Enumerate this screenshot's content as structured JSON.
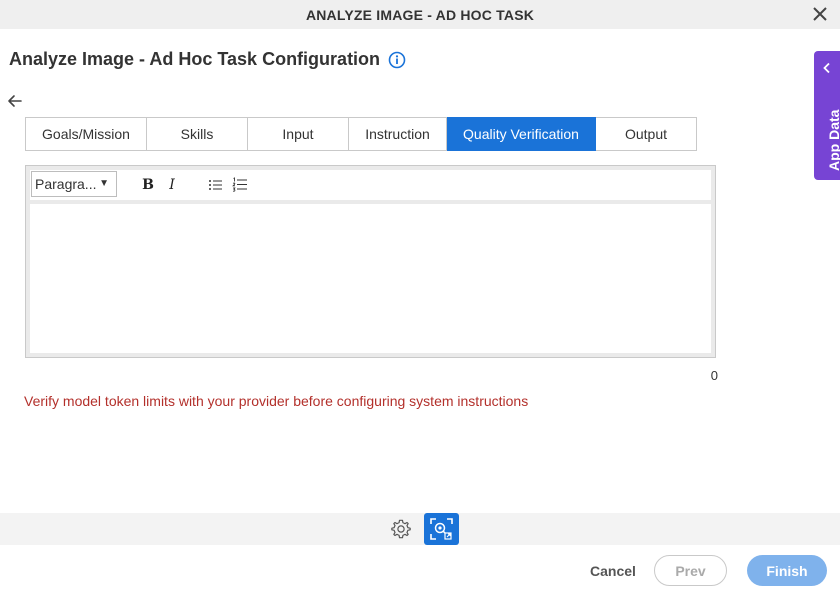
{
  "window": {
    "title": "ANALYZE IMAGE - AD HOC TASK"
  },
  "page": {
    "title": "Analyze Image - Ad Hoc Task Configuration"
  },
  "tabs": [
    {
      "label": "Goals/Mission",
      "active": false
    },
    {
      "label": "Skills",
      "active": false
    },
    {
      "label": "Input",
      "active": false
    },
    {
      "label": "Instruction",
      "active": false
    },
    {
      "label": "Quality Verification",
      "active": true
    },
    {
      "label": "Output",
      "active": false
    }
  ],
  "editor": {
    "format_select": "Paragra...",
    "bold_label": "B",
    "italic_label": "I",
    "content": "",
    "char_count": "0"
  },
  "warning": {
    "text": "Verify model token limits with your provider before configuring system instructions"
  },
  "app_data": {
    "label": "App Data"
  },
  "footer": {
    "cancel_label": "Cancel",
    "prev_label": "Prev",
    "finish_label": "Finish"
  },
  "colors": {
    "accent": "#1a73d8",
    "app_data_bg": "#7744d4",
    "warning": "#b3302b",
    "finish_disabled": "#7fb2ec"
  }
}
